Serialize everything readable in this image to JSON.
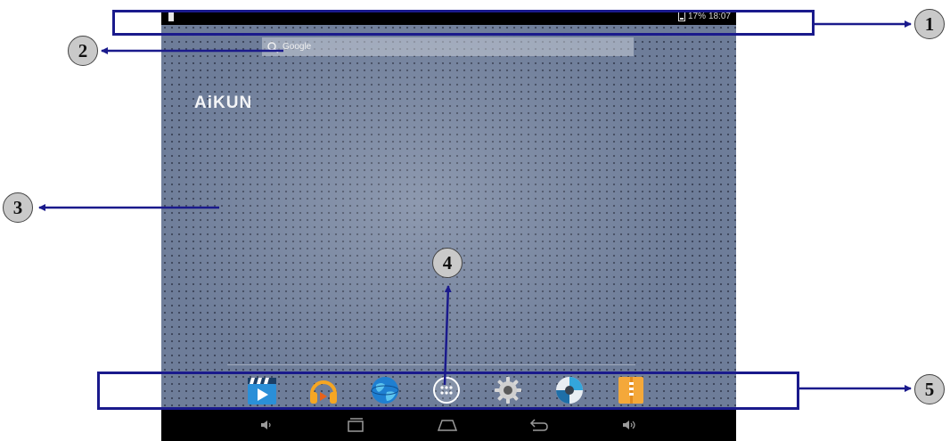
{
  "status_bar": {
    "battery": "17%",
    "time": "18:07"
  },
  "search": {
    "placeholder": "Google"
  },
  "wallpaper": {
    "logo_text": "AiKUN"
  },
  "dock": {
    "apps": [
      {
        "icon": "video-player-icon"
      },
      {
        "icon": "music-player-icon"
      },
      {
        "icon": "browser-globe-icon"
      },
      {
        "icon": "app-drawer-icon"
      },
      {
        "icon": "settings-gear-icon"
      },
      {
        "icon": "gallery-camera-icon"
      },
      {
        "icon": "file-archive-icon"
      }
    ]
  },
  "nav_bar": {
    "buttons": [
      "volume-down-icon",
      "recent-apps-icon",
      "home-icon",
      "back-icon",
      "volume-up-icon"
    ]
  },
  "callouts": [
    "1",
    "2",
    "3",
    "4",
    "5"
  ],
  "colors": {
    "annotation": "#1a1a8c",
    "badge": "#c9c9c9",
    "status_bar": "#000000"
  }
}
